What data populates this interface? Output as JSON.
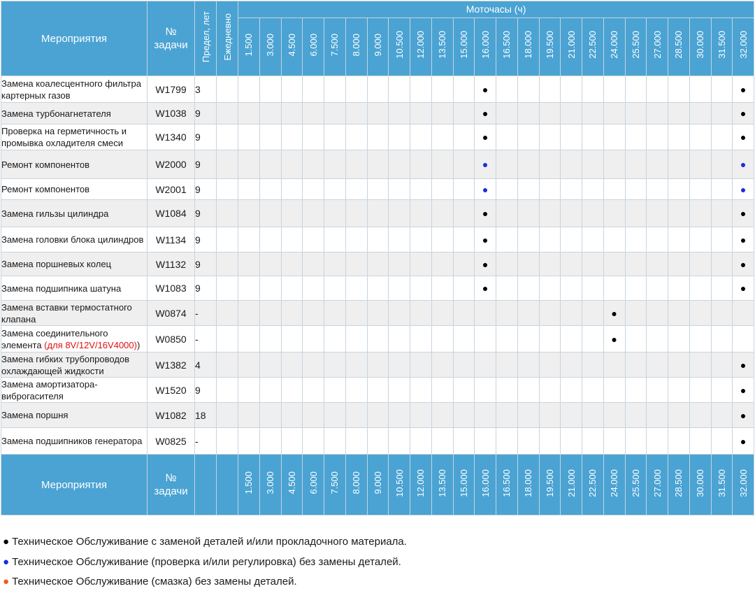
{
  "header": {
    "col_activity": "Мероприятия",
    "col_task": "№ задачи",
    "col_limit": "Предел, лет",
    "col_daily": "Ежедневно",
    "hours_title": "Моточасы (ч)",
    "hours": [
      "1.500",
      "3.000",
      "4.500",
      "6.000",
      "7.500",
      "8.000",
      "9.000",
      "10.500",
      "12.000",
      "13.500",
      "15.000",
      "16.000",
      "16.500",
      "18.000",
      "19.500",
      "21.000",
      "22.500",
      "24.000",
      "25.500",
      "27.000",
      "28.500",
      "30.000",
      "31.500",
      "32.000"
    ]
  },
  "rows": [
    {
      "activity": "Замена коалесцентного фильтра картерных газов",
      "task": "W1799",
      "limit": "3",
      "marks": [
        11,
        23
      ],
      "color": "black"
    },
    {
      "activity": "Замена турбонагнетателя",
      "task": "W1038",
      "limit": "9",
      "marks": [
        11,
        23
      ],
      "color": "black"
    },
    {
      "activity": "Проверка на герметичность и промывка охладителя смеси",
      "task": "W1340",
      "limit": "9",
      "marks": [
        11,
        23
      ],
      "color": "black"
    },
    {
      "activity": "Ремонт компонентов",
      "task": "W2000",
      "limit": "9",
      "marks": [
        11,
        23
      ],
      "color": "blue"
    },
    {
      "activity": "Ремонт компонентов",
      "task": "W2001",
      "limit": "9",
      "marks": [
        11,
        23
      ],
      "color": "blue"
    },
    {
      "activity": "Замена гильзы цилиндра",
      "task": "W1084",
      "limit": "9",
      "marks": [
        11,
        23
      ],
      "color": "black"
    },
    {
      "activity": "Замена головки блока цилиндров",
      "task": "W1134",
      "limit": "9",
      "marks": [
        11,
        23
      ],
      "color": "black"
    },
    {
      "activity": "Замена поршневых колец",
      "task": "W1132",
      "limit": "9",
      "marks": [
        11,
        23
      ],
      "color": "black"
    },
    {
      "activity": "Замена подшипника шатуна",
      "task": "W1083",
      "limit": "9",
      "marks": [
        11,
        23
      ],
      "color": "black"
    },
    {
      "activity": "Замена вставки термостатного клапана",
      "task": "W0874",
      "limit": "-",
      "marks": [
        17
      ],
      "color": "black"
    },
    {
      "activity": "Замена соединительного элемента ",
      "activity_note": "(для 8V/12V/16V4000)",
      "activity_after": ")",
      "task": "W0850",
      "limit": "-",
      "marks": [
        17
      ],
      "color": "black"
    },
    {
      "activity": "Замена гибких трубопроводов охлаждающей жидкости",
      "task": "W1382",
      "limit": "4",
      "marks": [
        23
      ],
      "color": "black"
    },
    {
      "activity": "Замена амортизатора-виброгасителя",
      "task": "W1520",
      "limit": "9",
      "marks": [
        23
      ],
      "color": "black"
    },
    {
      "activity": "Замена поршня",
      "task": "W1082",
      "limit": "18",
      "marks": [
        23
      ],
      "color": "black"
    },
    {
      "activity": "Замена подшипников генератора",
      "task": "W0825",
      "limit": "-",
      "marks": [
        23
      ],
      "color": "black"
    }
  ],
  "legend": [
    {
      "bullet": "●",
      "color": "#000000",
      "text": "Техническое Обслуживание с заменой деталей и/или прокладочного материала."
    },
    {
      "bullet": "●",
      "color": "#1a2de0",
      "text": "Техническое Обслуживание (проверка и/или регулировка) без замены деталей."
    },
    {
      "bullet": "●",
      "color": "#f05a1e",
      "text": "Техническое Обслуживание (смазка) без замены деталей."
    }
  ],
  "mark_glyph": "●",
  "colors": {
    "header_bg": "#4aa3d3",
    "black_dot": "#000000",
    "blue_dot": "#1a2de0",
    "orange_dot": "#f05a1e",
    "note_red": "#e01010"
  }
}
